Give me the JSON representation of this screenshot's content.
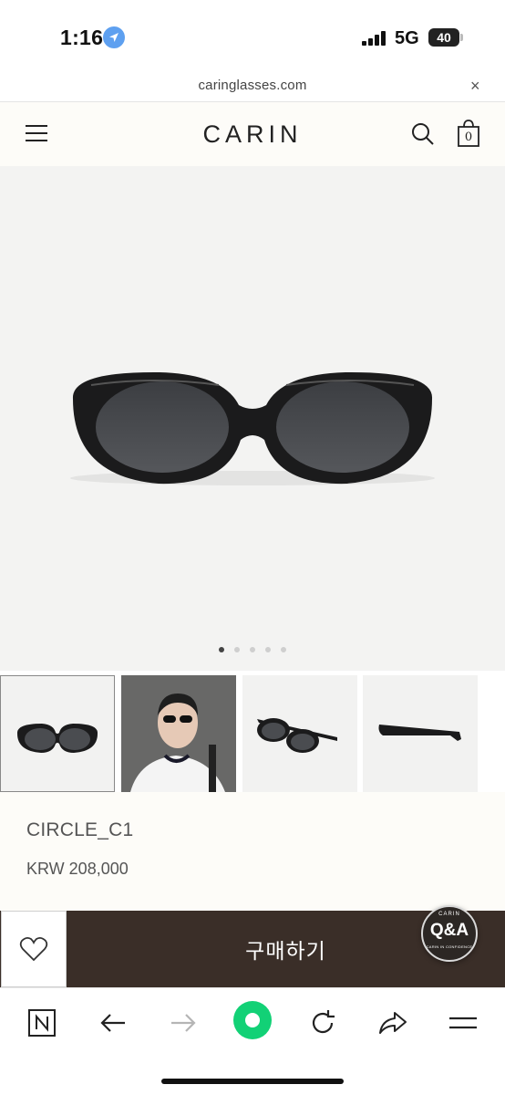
{
  "status": {
    "time": "1:16",
    "network": "5G",
    "battery": "40"
  },
  "browser": {
    "url": "caringlasses.com",
    "close_symbol": "×"
  },
  "header": {
    "logo": "CARIN",
    "cart_count": "0",
    "icons": [
      "menu-icon",
      "search-icon",
      "shopping-bag-icon"
    ]
  },
  "gallery": {
    "total_slides": 5,
    "active_slide": 1,
    "thumbnails": [
      "front view",
      "model wearing",
      "angled view",
      "side view"
    ]
  },
  "product": {
    "name": "CIRCLE_C1",
    "price": "KRW 208,000"
  },
  "purchase": {
    "buy_label": "구매하기",
    "wishlist_icon": "heart-icon"
  },
  "qa_badge": {
    "brand": "CARIN",
    "label": "Q&A",
    "sub": "CARIN IN CONFIDENCE"
  },
  "toolbar": {
    "buttons": [
      "naver-home-icon",
      "back-icon",
      "forward-icon",
      "green-dot-icon",
      "reload-icon",
      "share-icon",
      "menu-icon"
    ]
  },
  "colors": {
    "header_bg": "#fdfcf8",
    "buy_bar": "#3a2e28",
    "accent_green": "#12d176",
    "location_blue": "#5ea0f0"
  }
}
